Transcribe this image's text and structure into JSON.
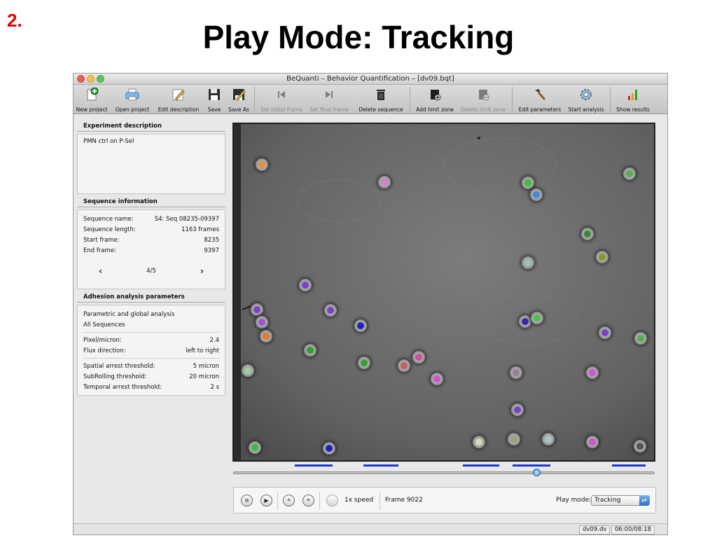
{
  "slide": {
    "number": "2.",
    "title": "Play Mode: Tracking"
  },
  "window": {
    "title": "BeQuanti – Behavior Quantification – [dv09.bqt]"
  },
  "toolbar": {
    "new_project": "New project",
    "open_project": "Open project",
    "edit_description": "Edit description",
    "save": "Save",
    "save_as": "Save As",
    "set_initial_frame": "Set initial frame",
    "set_final_frame": "Set final frame",
    "delete_sequence": "Delete sequence",
    "add_limit_zone": "Add limit zone",
    "delete_limit_zone": "Delete limit zone",
    "edit_parameters": "Edit parameters",
    "start_analysis": "Start analysis",
    "show_results": "Show results"
  },
  "experiment": {
    "header": "Experiment description",
    "text": "PMN ctrl on P-Sel"
  },
  "sequence": {
    "header": "Sequence information",
    "name_label": "Sequence name:",
    "name_value": "S4: Seq 08235-09397",
    "length_label": "Sequence length:",
    "length_value": "1163 frames",
    "start_label": "Start frame:",
    "start_value": "8235",
    "end_label": "End frame:",
    "end_value": "9397",
    "prev": "‹",
    "pager": "4/5",
    "next": "›"
  },
  "adhesion": {
    "header": "Adhesion analysis parameters",
    "analysis": "Parametric and global analysis",
    "scope": "All Sequences",
    "pixel_label": "Pixel/micron:",
    "pixel_value": "2.4",
    "flux_label": "Flux direction:",
    "flux_value": "left to right",
    "spatial_label": "Spatial arrest threshold:",
    "spatial_value": "5 micron",
    "subrolling_label": "SubRolling threshold:",
    "subrolling_value": "20 micron",
    "temporal_label": "Temporal arrest threshold:",
    "temporal_value": "2 s"
  },
  "player": {
    "stop_icon": "■",
    "play_icon": "▶",
    "rewind_icon": "«",
    "forward_icon": "»",
    "speed": "1x speed",
    "frame": "Frame 9022",
    "play_mode_label": "Play mode:",
    "play_mode_value": "Tracking",
    "select_arrow": "▴▾"
  },
  "status": {
    "file": "dv09.dv",
    "time": "06:00/08:18"
  },
  "colors": {
    "slide_number": "#e00000",
    "timeline_segments": "#1a38d8"
  }
}
